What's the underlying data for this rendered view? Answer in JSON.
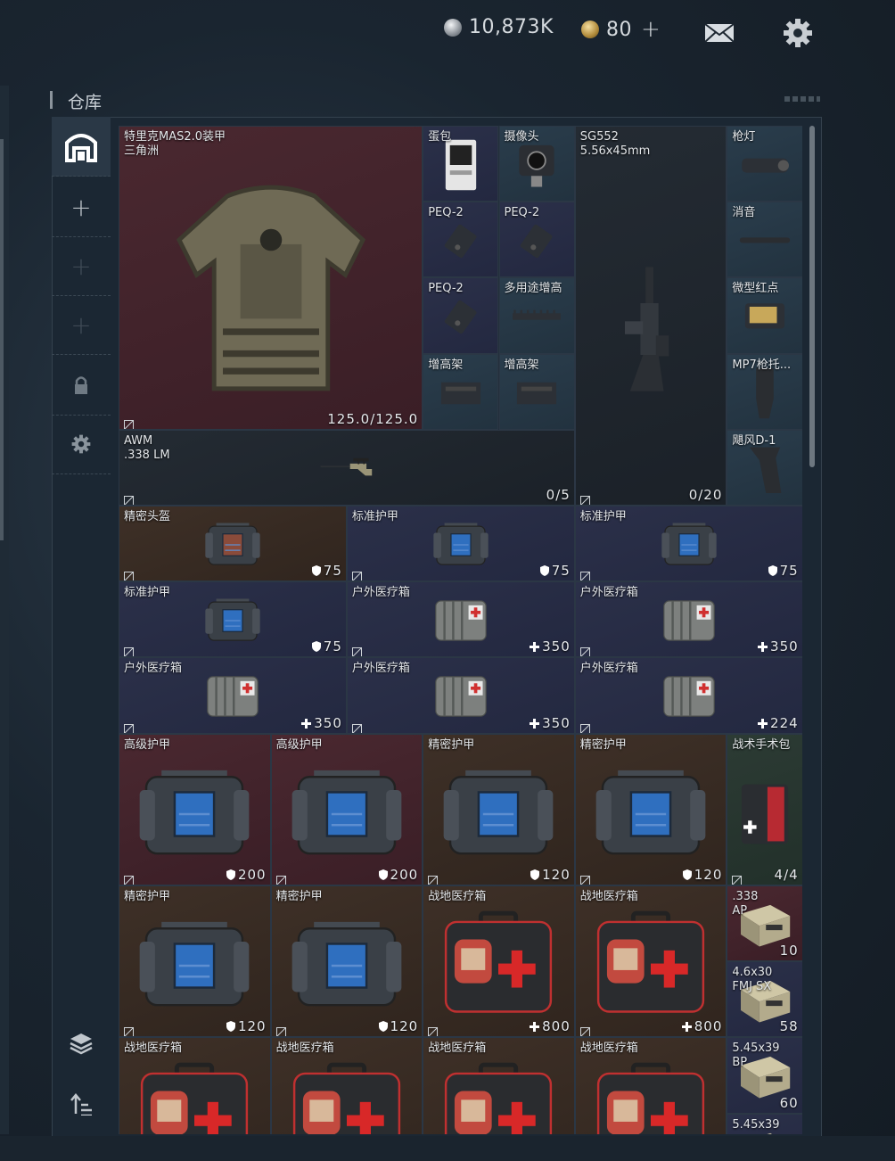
{
  "topbar": {
    "silver_amount": "10,873K",
    "gold_amount": "80",
    "add_label": "+",
    "icons": [
      "silver-coin-icon",
      "gold-coin-icon",
      "mail-icon",
      "gear-icon"
    ]
  },
  "title": "仓库",
  "sidebar": {
    "items": [
      {
        "name": "warehouse-icon",
        "glyph": ""
      },
      {
        "name": "add-icon",
        "glyph": "+"
      },
      {
        "name": "add-icon-disabled",
        "glyph": "+"
      },
      {
        "name": "add-icon-disabled-2",
        "glyph": "+"
      },
      {
        "name": "lock-icon",
        "glyph": ""
      },
      {
        "name": "settings-icon",
        "glyph": ""
      },
      {
        "name": "layers-icon",
        "glyph": ""
      },
      {
        "name": "sort-icon",
        "glyph": ""
      }
    ]
  },
  "items": [
    {
      "id": "armor",
      "name": "特里克MAS2.0装甲\n三角洲",
      "value": "125.0/125.0",
      "tint": "red",
      "icon": "body-armor-icon"
    },
    {
      "id": "egg",
      "name": "蛋包",
      "value": "",
      "tint": "navy",
      "icon": "egg-pack-icon"
    },
    {
      "id": "camera",
      "name": "摄像头",
      "value": "",
      "tint": "teal",
      "icon": "camera-icon"
    },
    {
      "id": "sg552",
      "name": "SG552\n5.56x45mm",
      "value": "0/20",
      "tint": "dark",
      "icon": "rifle-icon"
    },
    {
      "id": "flashlight",
      "name": "枪灯",
      "value": "",
      "tint": "teal",
      "icon": "flashlight-icon"
    },
    {
      "id": "peq1",
      "name": "PEQ-2",
      "value": "",
      "tint": "navy",
      "icon": "laser-module-icon"
    },
    {
      "id": "peq2",
      "name": "PEQ-2",
      "value": "",
      "tint": "navy",
      "icon": "laser-module-icon"
    },
    {
      "id": "suppressor",
      "name": "消音",
      "value": "",
      "tint": "teal",
      "icon": "suppressor-icon"
    },
    {
      "id": "peq3",
      "name": "PEQ-2",
      "value": "",
      "tint": "navy",
      "icon": "laser-module-icon"
    },
    {
      "id": "multirail",
      "name": "多用途增高",
      "value": "",
      "tint": "teal",
      "icon": "rail-icon"
    },
    {
      "id": "reddot",
      "name": "微型红点",
      "value": "",
      "tint": "teal",
      "icon": "red-dot-icon"
    },
    {
      "id": "riser1",
      "name": "增高架",
      "value": "",
      "tint": "teal",
      "icon": "riser-icon"
    },
    {
      "id": "riser2",
      "name": "增高架",
      "value": "",
      "tint": "teal",
      "icon": "riser-icon"
    },
    {
      "id": "mp7",
      "name": "MP7枪托...",
      "value": "",
      "tint": "teal",
      "icon": "stock-icon"
    },
    {
      "id": "awm",
      "name": "AWM\n.338 LM",
      "value": "0/5",
      "tint": "dark",
      "icon": "sniper-rifle-icon"
    },
    {
      "id": "grip",
      "name": "飓风D-1",
      "value": "",
      "tint": "teal",
      "icon": "grip-icon"
    },
    {
      "id": "helmet",
      "name": "精密头盔",
      "value": "75",
      "tint": "brown",
      "icon": "helmet-case-icon"
    },
    {
      "id": "std1",
      "name": "标准护甲",
      "value": "75",
      "tint": "navy",
      "icon": "armor-case-icon"
    },
    {
      "id": "std2",
      "name": "标准护甲",
      "value": "75",
      "tint": "navy",
      "icon": "armor-case-icon"
    },
    {
      "id": "std3",
      "name": "标准护甲",
      "value": "75",
      "tint": "navy",
      "icon": "armor-case-icon"
    },
    {
      "id": "med1",
      "name": "户外医疗箱",
      "value": "350",
      "tint": "navy",
      "icon": "medkit-pouch-icon"
    },
    {
      "id": "med2",
      "name": "户外医疗箱",
      "value": "350",
      "tint": "navy",
      "icon": "medkit-pouch-icon"
    },
    {
      "id": "med3",
      "name": "户外医疗箱",
      "value": "350",
      "tint": "navy",
      "icon": "medkit-pouch-icon"
    },
    {
      "id": "med4",
      "name": "户外医疗箱",
      "value": "350",
      "tint": "navy",
      "icon": "medkit-pouch-icon"
    },
    {
      "id": "med5",
      "name": "户外医疗箱",
      "value": "224",
      "tint": "navy",
      "icon": "medkit-pouch-icon"
    },
    {
      "id": "adv1",
      "name": "高级护甲",
      "value": "200",
      "tint": "red",
      "icon": "armor-case-icon"
    },
    {
      "id": "adv2",
      "name": "高级护甲",
      "value": "200",
      "tint": "red",
      "icon": "armor-case-icon"
    },
    {
      "id": "prec1",
      "name": "精密护甲",
      "value": "120",
      "tint": "brown",
      "icon": "armor-case-icon"
    },
    {
      "id": "prec2",
      "name": "精密护甲",
      "value": "120",
      "tint": "brown",
      "icon": "armor-case-icon"
    },
    {
      "id": "surg",
      "name": "战术手术包",
      "value": "4/4",
      "tint": "green",
      "icon": "surgical-kit-icon"
    },
    {
      "id": "prec3",
      "name": "精密护甲",
      "value": "120",
      "tint": "brown",
      "icon": "armor-case-icon"
    },
    {
      "id": "prec4",
      "name": "精密护甲",
      "value": "120",
      "tint": "brown",
      "icon": "armor-case-icon"
    },
    {
      "id": "field1",
      "name": "战地医疗箱",
      "value": "800",
      "tint": "brown",
      "icon": "field-medkit-icon"
    },
    {
      "id": "field2",
      "name": "战地医疗箱",
      "value": "800",
      "tint": "brown",
      "icon": "field-medkit-icon"
    },
    {
      "id": "ammo338",
      "name": ".338\nAP",
      "value": "10",
      "tint": "red",
      "icon": "ammo-box-icon"
    },
    {
      "id": "ammo46",
      "name": "4.6x30\nFMJ SX",
      "value": "58",
      "tint": "navy",
      "icon": "ammo-box-icon"
    },
    {
      "id": "field3",
      "name": "战地医疗箱",
      "value": "",
      "tint": "brown",
      "icon": "field-medkit-icon"
    },
    {
      "id": "field4",
      "name": "战地医疗箱",
      "value": "",
      "tint": "brown",
      "icon": "field-medkit-icon"
    },
    {
      "id": "field5",
      "name": "战地医疗箱",
      "value": "",
      "tint": "brown",
      "icon": "field-medkit-icon"
    },
    {
      "id": "field6",
      "name": "战地医疗箱",
      "value": "",
      "tint": "brown",
      "icon": "field-medkit-icon"
    },
    {
      "id": "ammo545",
      "name": "5.45x39\nBP",
      "value": "60",
      "tint": "navy",
      "icon": "ammo-box-icon"
    },
    {
      "id": "ammo545b",
      "name": "5.45x39",
      "value": "",
      "tint": "navy",
      "icon": "ammo-box-icon"
    }
  ]
}
